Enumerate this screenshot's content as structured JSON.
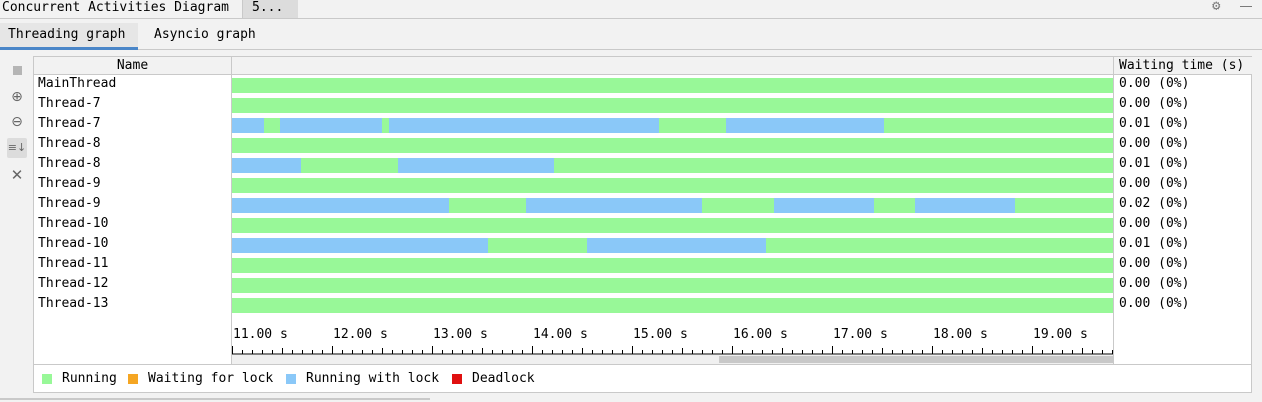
{
  "window": {
    "title": "Concurrent Activities Diagram",
    "tab": "5..."
  },
  "tabs": {
    "threading": "Threading graph",
    "asyncio": "Asyncio graph"
  },
  "columns": {
    "name": "Name",
    "waiting": "Waiting time (s)"
  },
  "threads": [
    {
      "name": "MainThread",
      "wait": "0.00 (0%)",
      "segments": [
        {
          "state": "running",
          "from": 11.0,
          "to": 19.87
        }
      ]
    },
    {
      "name": "Thread-7",
      "wait": "0.00 (0%)",
      "segments": [
        {
          "state": "running",
          "from": 11.0,
          "to": 19.99
        }
      ]
    },
    {
      "name": "Thread-7",
      "wait": "0.01 (0%)",
      "segments": [
        {
          "state": "running_with_lock",
          "from": 11.0,
          "to": 11.32
        },
        {
          "state": "running",
          "from": 11.32,
          "to": 11.48
        },
        {
          "state": "running_with_lock",
          "from": 11.48,
          "to": 12.5
        },
        {
          "state": "running",
          "from": 12.5,
          "to": 12.57
        },
        {
          "state": "running_with_lock",
          "from": 12.57,
          "to": 15.27
        },
        {
          "state": "running",
          "from": 15.27,
          "to": 15.94
        },
        {
          "state": "running_with_lock",
          "from": 15.94,
          "to": 17.52
        },
        {
          "state": "running",
          "from": 17.52,
          "to": 19.87
        }
      ]
    },
    {
      "name": "Thread-8",
      "wait": "0.00 (0%)",
      "segments": [
        {
          "state": "running",
          "from": 11.0,
          "to": 19.99
        }
      ]
    },
    {
      "name": "Thread-8",
      "wait": "0.01 (0%)",
      "segments": [
        {
          "state": "running_with_lock",
          "from": 11.0,
          "to": 11.69
        },
        {
          "state": "running",
          "from": 11.69,
          "to": 12.66
        },
        {
          "state": "running_with_lock",
          "from": 12.66,
          "to": 14.22
        },
        {
          "state": "running",
          "from": 14.22,
          "to": 19.87
        }
      ]
    },
    {
      "name": "Thread-9",
      "wait": "0.00 (0%)",
      "segments": [
        {
          "state": "running",
          "from": 11.0,
          "to": 19.99
        }
      ]
    },
    {
      "name": "Thread-9",
      "wait": "0.02 (0%)",
      "segments": [
        {
          "state": "running_with_lock",
          "from": 11.0,
          "to": 13.17
        },
        {
          "state": "running",
          "from": 13.17,
          "to": 13.94
        },
        {
          "state": "running_with_lock",
          "from": 13.94,
          "to": 15.7
        },
        {
          "state": "running",
          "from": 15.7,
          "to": 16.42
        },
        {
          "state": "running_with_lock",
          "from": 16.42,
          "to": 17.42
        },
        {
          "state": "running",
          "from": 17.42,
          "to": 17.83
        },
        {
          "state": "running_with_lock",
          "from": 17.83,
          "to": 18.83
        },
        {
          "state": "running",
          "from": 18.83,
          "to": 19.87
        }
      ]
    },
    {
      "name": "Thread-10",
      "wait": "0.00 (0%)",
      "segments": [
        {
          "state": "running",
          "from": 11.0,
          "to": 19.99
        }
      ]
    },
    {
      "name": "Thread-10",
      "wait": "0.01 (0%)",
      "segments": [
        {
          "state": "running_with_lock",
          "from": 11.0,
          "to": 13.56
        },
        {
          "state": "running",
          "from": 13.56,
          "to": 14.55
        },
        {
          "state": "running_with_lock",
          "from": 14.55,
          "to": 16.34
        },
        {
          "state": "running",
          "from": 16.34,
          "to": 19.87
        }
      ]
    },
    {
      "name": "Thread-11",
      "wait": "0.00 (0%)",
      "segments": [
        {
          "state": "running",
          "from": 11.0,
          "to": 19.87
        }
      ]
    },
    {
      "name": "Thread-12",
      "wait": "0.00 (0%)",
      "segments": [
        {
          "state": "running",
          "from": 11.0,
          "to": 19.85
        }
      ]
    },
    {
      "name": "Thread-13",
      "wait": "0.00 (0%)",
      "segments": [
        {
          "state": "running",
          "from": 11.0,
          "to": 19.85
        }
      ]
    }
  ],
  "axis": {
    "ticks": [
      {
        "value": 11.0,
        "label": "11.00 s"
      },
      {
        "value": 12.0,
        "label": "12.00 s"
      },
      {
        "value": 13.0,
        "label": "13.00 s"
      },
      {
        "value": 14.0,
        "label": "14.00 s"
      },
      {
        "value": 15.0,
        "label": "15.00 s"
      },
      {
        "value": 16.0,
        "label": "16.00 s"
      },
      {
        "value": 17.0,
        "label": "17.00 s"
      },
      {
        "value": 18.0,
        "label": "18.00 s"
      },
      {
        "value": 19.0,
        "label": "19.00 s"
      }
    ],
    "visible_from": 11.0,
    "visible_to": 19.99,
    "scrollbar_thumb": [
      15.97,
      19.99
    ]
  },
  "legend": [
    {
      "state": "running",
      "label": "Running",
      "color": "#98f898"
    },
    {
      "state": "waiting",
      "label": "Waiting for lock",
      "color": "#f5a623"
    },
    {
      "state": "running_with_lock",
      "label": "Running with lock",
      "color": "#8ac8f8"
    },
    {
      "state": "deadlock",
      "label": "Deadlock",
      "color": "#e01010"
    }
  ],
  "icons": {
    "settings": "gear-icon",
    "minimize": "minimize-icon",
    "stop": "stop-icon",
    "zoom_in": "zoom-in-icon",
    "zoom_out": "zoom-out-icon",
    "scroll_to_end": "scroll-to-end-icon",
    "close": "close-icon"
  }
}
